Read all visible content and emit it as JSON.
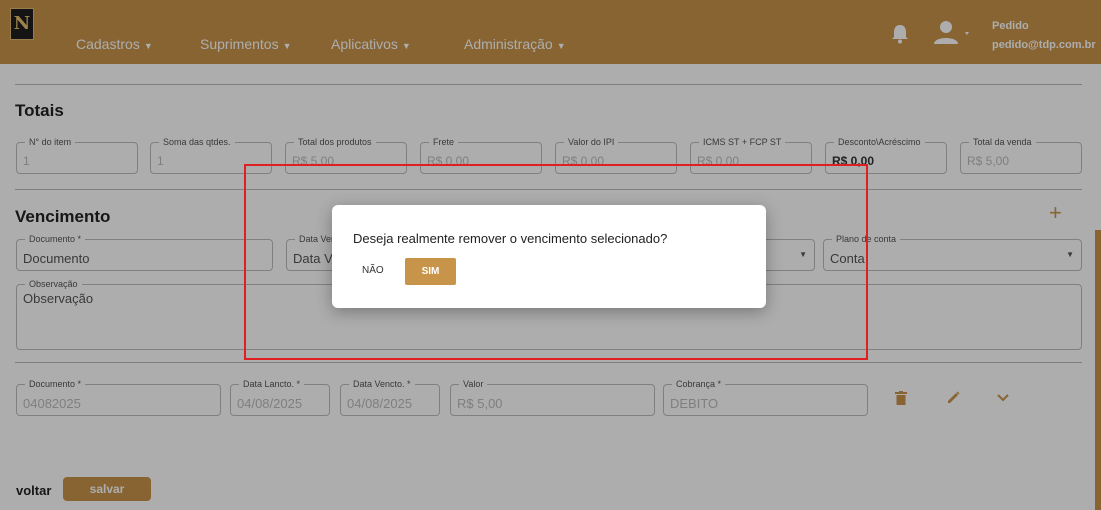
{
  "navbar": {
    "logo_text": "N",
    "menus": [
      {
        "label": "Cadastros"
      },
      {
        "label": "Suprimentos"
      },
      {
        "label": "Aplicativos"
      },
      {
        "label": "Administração"
      }
    ],
    "user_name": "Pedido",
    "user_email": "pedido@tdp.com.br",
    "accent_color": "#c8944a"
  },
  "totais": {
    "title": "Totais",
    "fields": [
      {
        "label": "N° do item",
        "value": "1"
      },
      {
        "label": "Soma das qtdes.",
        "value": "1"
      },
      {
        "label": "Total dos produtos",
        "value": "R$ 5,00"
      },
      {
        "label": "Frete",
        "value": "R$ 0,00"
      },
      {
        "label": "Valor do IPI",
        "value": "R$ 0,00"
      },
      {
        "label": "ICMS ST + FCP ST",
        "value": "R$ 0,00"
      },
      {
        "label": "Desconto\\Acréscimo",
        "value": "R$ 0,00"
      },
      {
        "label": "Total da venda",
        "value": "R$ 5,00"
      }
    ]
  },
  "vencimento": {
    "title": "Vencimento",
    "add_icon": "plus-icon",
    "form": {
      "documento_label": "Documento *",
      "documento_placeholder": "Documento",
      "data_label": "Data Venc",
      "data_placeholder": "Data V",
      "plano_label": "Plano de conta",
      "plano_placeholder": "Conta",
      "observacao_label": "Observação",
      "observacao_placeholder": "Observação"
    },
    "row": {
      "documento_label": "Documento *",
      "documento_value": "04082025",
      "data_lancto_label": "Data Lancto. *",
      "data_lancto_value": "04/08/2025",
      "data_vencto_label": "Data Vencto. *",
      "data_vencto_value": "04/08/2025",
      "valor_label": "Valor",
      "valor_value": "R$ 5,00",
      "cobranca_label": "Cobrança *",
      "cobranca_value": "DEBITO"
    }
  },
  "footer": {
    "voltar_label": "voltar",
    "salvar_label": "salvar"
  },
  "dialog": {
    "message": "Deseja realmente remover o vencimento selecionado?",
    "no_label": "NÃO",
    "yes_label": "SIM"
  }
}
